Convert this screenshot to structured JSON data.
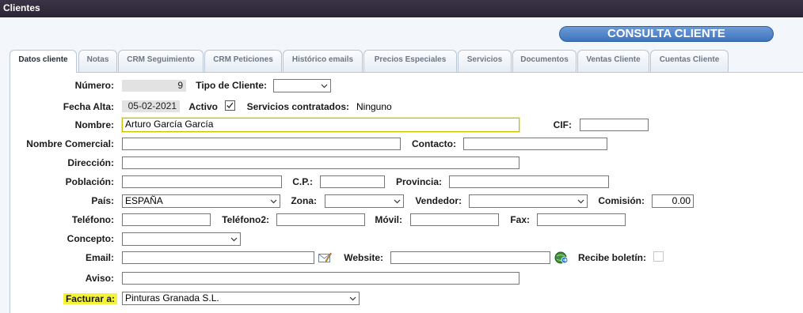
{
  "window": {
    "title": "Clientes"
  },
  "header": {
    "badge": "CONSULTA CLIENTE"
  },
  "tabs": [
    {
      "label": "Datos cliente"
    },
    {
      "label": "Notas"
    },
    {
      "label": "CRM Seguimiento"
    },
    {
      "label": "CRM Peticiones"
    },
    {
      "label": "Histórico emails"
    },
    {
      "label": "Precios Especiales"
    },
    {
      "label": "Servicios"
    },
    {
      "label": "Documentos"
    },
    {
      "label": "Ventas Cliente"
    },
    {
      "label": "Cuentas Cliente"
    }
  ],
  "form": {
    "numero": {
      "label": "Número:",
      "value": "9"
    },
    "tipo_cliente": {
      "label": "Tipo de Cliente:",
      "value": ""
    },
    "fecha_alta": {
      "label": "Fecha Alta:",
      "value": "05-02-2021"
    },
    "activo": {
      "label": "Activo",
      "checked": true
    },
    "servicios": {
      "label": "Servicios contratados:",
      "value": "Ninguno"
    },
    "nombre": {
      "label": "Nombre:",
      "value": "Arturo García García"
    },
    "cif": {
      "label": "CIF:",
      "value": ""
    },
    "nombre_comercial": {
      "label": "Nombre Comercial:",
      "value": ""
    },
    "contacto": {
      "label": "Contacto:",
      "value": ""
    },
    "direccion": {
      "label": "Dirección:",
      "value": ""
    },
    "poblacion": {
      "label": "Población:",
      "value": ""
    },
    "cp": {
      "label": "C.P.:",
      "value": ""
    },
    "provincia": {
      "label": "Provincia:",
      "value": ""
    },
    "pais": {
      "label": "País:",
      "value": "ESPAÑA"
    },
    "zona": {
      "label": "Zona:",
      "value": ""
    },
    "vendedor": {
      "label": "Vendedor:",
      "value": ""
    },
    "comision": {
      "label": "Comisión:",
      "value": "0.00"
    },
    "telefono": {
      "label": "Teléfono:",
      "value": ""
    },
    "telefono2": {
      "label": "Teléfono2:",
      "value": ""
    },
    "movil": {
      "label": "Móvil:",
      "value": ""
    },
    "fax": {
      "label": "Fax:",
      "value": ""
    },
    "concepto": {
      "label": "Concepto:",
      "value": ""
    },
    "email": {
      "label": "Email:",
      "value": ""
    },
    "website": {
      "label": "Website:",
      "value": ""
    },
    "recibe_boletin": {
      "label": "Recibe boletín:",
      "checked": false
    },
    "aviso": {
      "label": "Aviso:",
      "value": ""
    },
    "facturar_a": {
      "label": "Facturar a:",
      "value": "Pinturas Granada S.L."
    }
  },
  "icons": {
    "email": "email-compose-icon",
    "website": "globe-go-icon"
  },
  "colors": {
    "titlebar": "#2f2938",
    "accent": "#3f74bd",
    "highlight": "#f4f33a"
  }
}
